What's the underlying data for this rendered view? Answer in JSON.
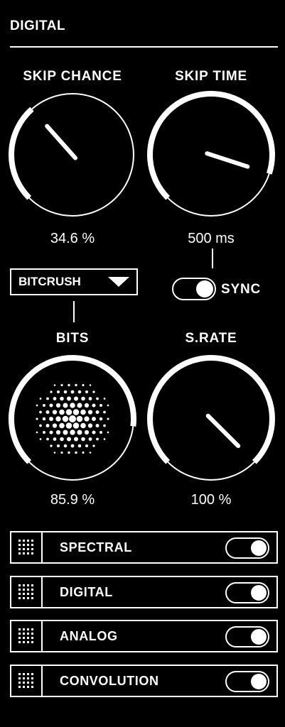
{
  "header": {
    "title": "DIGITAL"
  },
  "knobs": [
    {
      "id": "skip-chance",
      "label": "SKIP CHANCE",
      "value": "34.6 %",
      "fraction": 0.346
    },
    {
      "id": "skip-time",
      "label": "SKIP TIME",
      "value": "500 ms",
      "fraction": 0.9
    },
    {
      "id": "bits",
      "label": "BITS",
      "value": "85.9 %",
      "fraction": 0.859
    },
    {
      "id": "sample-rate",
      "label": "S.RATE",
      "value": "100 %",
      "fraction": 1.0
    }
  ],
  "mode_select": {
    "selected": "BITCRUSH"
  },
  "sync": {
    "label": "SYNC",
    "on": true
  },
  "modules": [
    {
      "name": "SPECTRAL",
      "enabled": true
    },
    {
      "name": "DIGITAL",
      "enabled": true
    },
    {
      "name": "ANALOG",
      "enabled": true
    },
    {
      "name": "CONVOLUTION",
      "enabled": true
    }
  ],
  "colors": {
    "background": "#000000",
    "foreground": "#ffffff"
  }
}
